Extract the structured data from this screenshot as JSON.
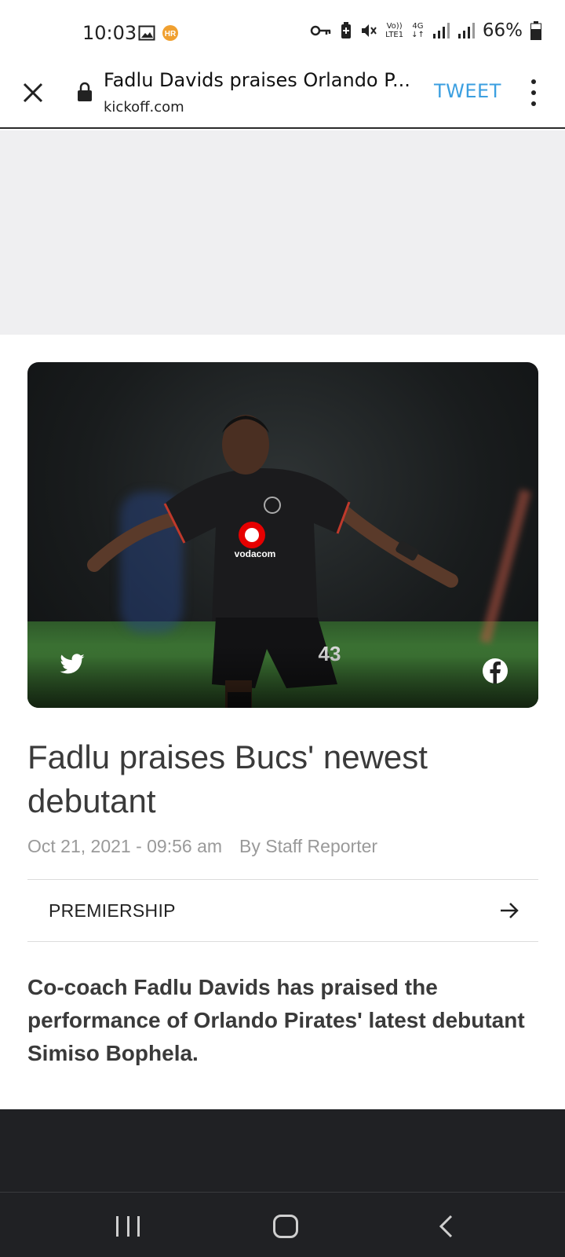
{
  "status_bar": {
    "time": "10:03",
    "battery": "66%",
    "network": "4G",
    "volte_top": "Vo))",
    "volte_bottom": "LTE1",
    "notification_badge": "HR",
    "icons": [
      "image-icon",
      "notification-badge-icon",
      "vpn-key-icon",
      "battery-saver-icon",
      "mute-icon",
      "volte-icon",
      "data-4g-icon",
      "signal-icon",
      "signal-icon",
      "battery-icon"
    ]
  },
  "toolbar": {
    "title": "Fadlu Davids praises Orlando P...",
    "url": "kickoff.com",
    "tweet_label": "TWEET"
  },
  "colors": {
    "tweet": "#3b9fe0",
    "ad_background": "#efeff1",
    "text": "#3a3a3a",
    "meta": "#9a9a9a",
    "footer": "#202124"
  },
  "hero": {
    "jersey_sponsor": "vodacom",
    "jersey_number": "43",
    "share_icons": [
      "twitter-icon",
      "facebook-icon"
    ]
  },
  "article": {
    "headline": "Fadlu praises Bucs' newest debutant",
    "date": "Oct 21, 2021 - 09:56 am",
    "author": "By Staff Reporter",
    "category": "PREMIERSHIP",
    "lead": "Co-coach Fadlu Davids has praised the performance of Orlando Pirates' latest debutant Simiso Bophela."
  },
  "navbar": {
    "buttons": [
      "recent-apps",
      "home",
      "back"
    ]
  }
}
